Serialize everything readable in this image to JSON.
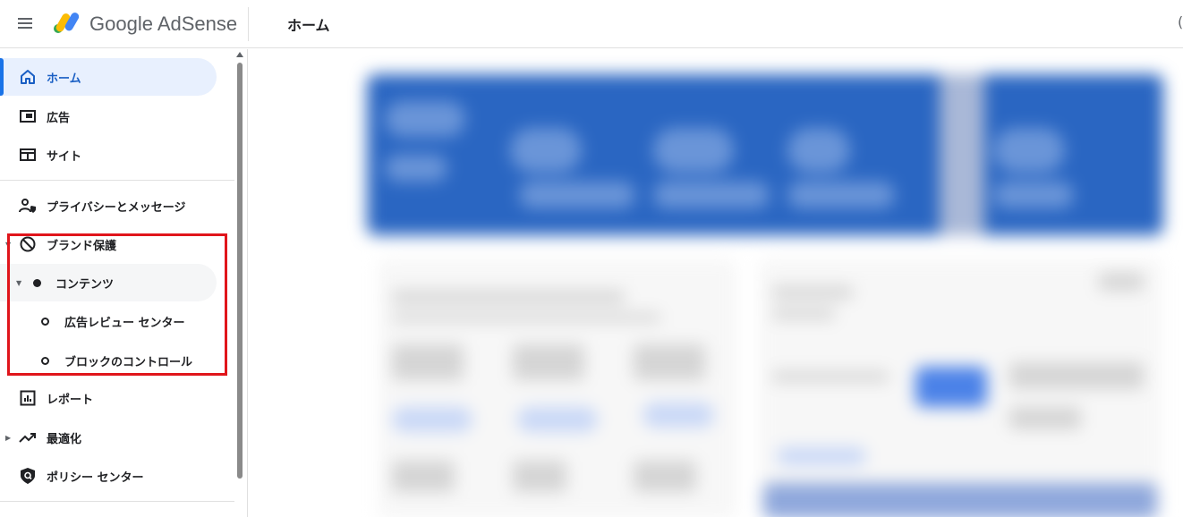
{
  "header": {
    "menu_icon": "hamburger-menu-icon",
    "brand": "Google AdSense",
    "page_title": "ホーム",
    "edge_char": "("
  },
  "sidebar": {
    "items": [
      {
        "id": "home",
        "label": "ホーム",
        "icon": "home-icon",
        "active": true
      },
      {
        "id": "ads",
        "label": "広告",
        "icon": "ads-icon"
      },
      {
        "id": "sites",
        "label": "サイト",
        "icon": "sites-icon"
      },
      {
        "id": "privacy",
        "label": "プライバシーとメッセージ",
        "icon": "privacy-messaging-icon"
      },
      {
        "id": "brand-safety",
        "label": "ブランド保護",
        "icon": "block-icon",
        "expanded": true
      },
      {
        "id": "content",
        "label": "コンテンツ",
        "icon": "filled-dot-icon",
        "expanded": true
      },
      {
        "id": "ad-review-center",
        "label": "広告レビュー センター",
        "icon": "hollow-dot-icon"
      },
      {
        "id": "blocking-controls",
        "label": "ブロックのコントロール",
        "icon": "hollow-dot-icon"
      },
      {
        "id": "reports",
        "label": "レポート",
        "icon": "reports-icon"
      },
      {
        "id": "optimization",
        "label": "最適化",
        "icon": "trending-up-icon"
      },
      {
        "id": "policy-center",
        "label": "ポリシー センター",
        "icon": "policy-shield-icon"
      }
    ]
  },
  "colors": {
    "accent": "#1a73e8",
    "active_bg": "#e8f0fe",
    "highlight": "#e0151b",
    "banner": "#2a66c2"
  }
}
